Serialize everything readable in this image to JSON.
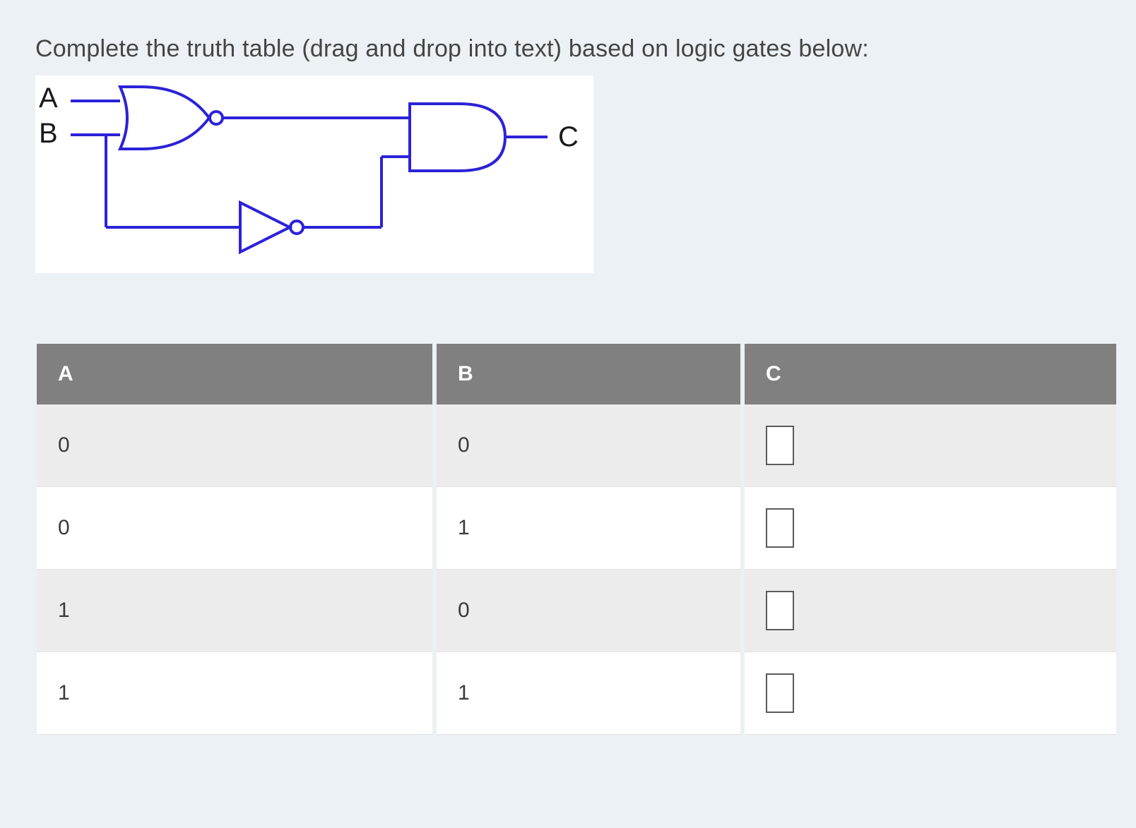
{
  "prompt": "Complete the truth table (drag and drop into text) based on logic gates below:",
  "diagram": {
    "labels": {
      "A": "A",
      "B": "B",
      "C": "C"
    }
  },
  "table": {
    "headers": {
      "A": "A",
      "B": "B",
      "C": "C"
    },
    "rows": [
      {
        "A": "0",
        "B": "0",
        "C": ""
      },
      {
        "A": "0",
        "B": "1",
        "C": ""
      },
      {
        "A": "1",
        "B": "0",
        "C": ""
      },
      {
        "A": "1",
        "B": "1",
        "C": ""
      }
    ]
  }
}
